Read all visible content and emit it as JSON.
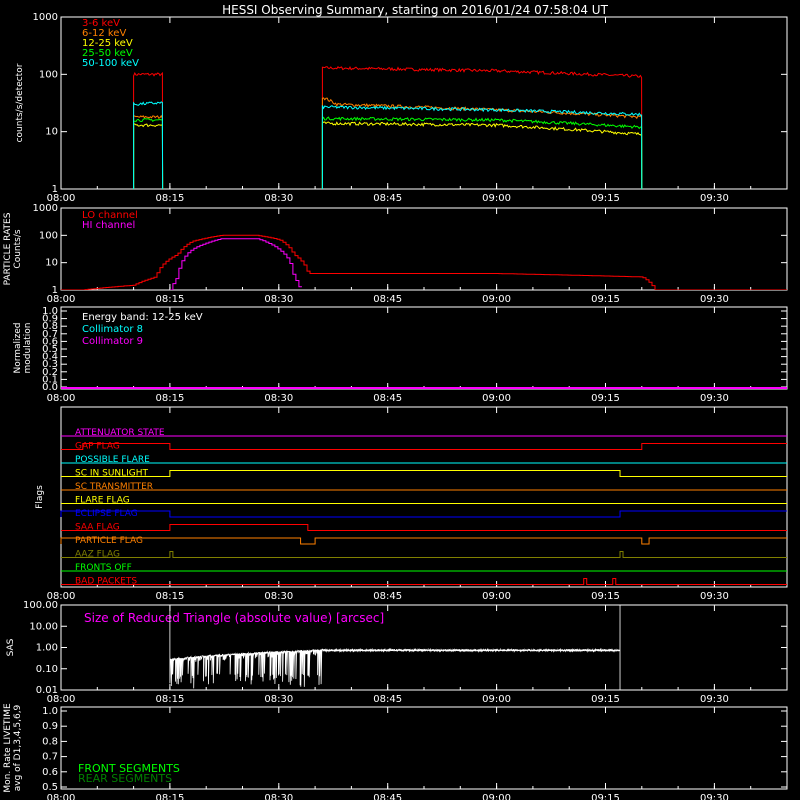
{
  "title": "HESSI Observing Summary, starting on 2016/01/24 07:58:04 UT",
  "time_axis": {
    "start": "08:00",
    "end": "09:40",
    "ticks": [
      "08:00",
      "08:15",
      "08:30",
      "08:45",
      "09:00",
      "09:15",
      "09:30"
    ]
  },
  "colors": {
    "background": "#000000",
    "axes": "#ffffff",
    "band_3_6": "#ff0000",
    "band_6_12": "#ff8000",
    "band_12_25": "#ffff00",
    "band_25_50": "#00ff00",
    "band_50_100": "#00ffff",
    "lo_channel": "#ff0000",
    "hi_channel": "#ff00ff",
    "collimator_8": "#00ffff",
    "collimator_9": "#ff00ff",
    "sas_trace": "#ffffff",
    "front_segments": "#00ff00",
    "rear_segments": "#008000"
  },
  "chart_data": [
    {
      "id": "count-rates",
      "type": "line",
      "ylabel": "counts/s/detector",
      "yscale": "log",
      "ylim": [
        1,
        1000
      ],
      "yticks": [
        "1",
        "10",
        "100",
        "1000"
      ],
      "legend": [
        "3-6 keV",
        "6-12 keV",
        "12-25 keV",
        "25-50 keV",
        "50-100 keV"
      ],
      "legend_placement": "top-left",
      "series": [
        {
          "name": "3-6 keV",
          "color": "#ff0000",
          "segments": [
            [
              [
                "08:10",
                "100"
              ],
              [
                "08:14",
                "100"
              ]
            ],
            [
              [
                "08:36",
                "130"
              ],
              [
                "09:00",
                "115"
              ],
              [
                "09:20",
                "92"
              ]
            ]
          ]
        },
        {
          "name": "6-12 keV",
          "color": "#ff8000",
          "segments": [
            [
              [
                "08:10",
                "18"
              ],
              [
                "08:14",
                "18"
              ]
            ],
            [
              [
                "08:36",
                "40"
              ],
              [
                "08:38",
                "30"
              ],
              [
                "08:45",
                "28"
              ],
              [
                "09:00",
                "24"
              ],
              [
                "09:20",
                "18"
              ]
            ]
          ]
        },
        {
          "name": "12-25 keV",
          "color": "#ffff00",
          "segments": [
            [
              [
                "08:10",
                "13"
              ],
              [
                "08:14",
                "13"
              ]
            ],
            [
              [
                "08:36",
                "14"
              ],
              [
                "09:00",
                "13"
              ],
              [
                "09:20",
                "9"
              ]
            ]
          ]
        },
        {
          "name": "25-50 keV",
          "color": "#00ff00",
          "segments": [
            [
              [
                "08:10",
                "16"
              ],
              [
                "08:14",
                "16"
              ]
            ],
            [
              [
                "08:36",
                "17"
              ],
              [
                "09:00",
                "16"
              ],
              [
                "09:20",
                "12"
              ]
            ]
          ]
        },
        {
          "name": "50-100 keV",
          "color": "#00ffff",
          "segments": [
            [
              [
                "08:10",
                "30"
              ],
              [
                "08:14",
                "32"
              ]
            ],
            [
              [
                "08:36",
                "27"
              ],
              [
                "09:00",
                "24"
              ],
              [
                "09:20",
                "20"
              ]
            ]
          ]
        }
      ]
    },
    {
      "id": "particle-rates",
      "type": "line",
      "ylabel": "PARTICLE RATES Counts/s",
      "yscale": "log",
      "ylim": [
        1,
        1000
      ],
      "yticks": [
        "1",
        "10",
        "100",
        "1000"
      ],
      "legend": [
        "LO channel",
        "HI channel"
      ],
      "legend_placement": "top-left",
      "series": [
        {
          "name": "LO channel",
          "color": "#ff0000",
          "points": [
            [
              "08:00",
              "0.8"
            ],
            [
              "08:10",
              "1.5"
            ],
            [
              "08:13",
              "3"
            ],
            [
              "08:16",
              "20"
            ],
            [
              "08:18",
              "60"
            ],
            [
              "08:22",
              "100"
            ],
            [
              "08:27",
              "100"
            ],
            [
              "08:30",
              "70"
            ],
            [
              "08:32",
              "20"
            ],
            [
              "08:34",
              "4"
            ],
            [
              "09:00",
              "4"
            ],
            [
              "09:20",
              "3"
            ],
            [
              "09:22",
              "0.8"
            ],
            [
              "09:40",
              "0.8"
            ]
          ]
        },
        {
          "name": "HI channel",
          "color": "#ff00ff",
          "points": [
            [
              "08:15",
              "0.8"
            ],
            [
              "08:16",
              "3"
            ],
            [
              "08:18",
              "30"
            ],
            [
              "08:22",
              "75"
            ],
            [
              "08:27",
              "75"
            ],
            [
              "08:30",
              "30"
            ],
            [
              "08:32",
              "3"
            ],
            [
              "08:33",
              "0.8"
            ]
          ]
        }
      ]
    },
    {
      "id": "modulation",
      "type": "line",
      "ylabel": "Normalized modulation",
      "ylim": [
        0.0,
        1.0
      ],
      "yticks": [
        "0.0",
        "0.1",
        "0.2",
        "0.3",
        "0.4",
        "0.5",
        "0.6",
        "0.7",
        "0.8",
        "0.9",
        "1.0"
      ],
      "legend": [
        "Energy band: 12-25 keV",
        "Collimator 8",
        "Collimator 9"
      ],
      "legend_placement": "top-left",
      "series": [
        {
          "name": "Collimator 8",
          "color": "#00ffff",
          "points": [
            [
              "08:00",
              "0.0"
            ],
            [
              "09:40",
              "0.0"
            ]
          ]
        },
        {
          "name": "Collimator 9",
          "color": "#ff00ff",
          "points": [
            [
              "08:00",
              "0.0"
            ],
            [
              "09:40",
              "0.0"
            ]
          ]
        }
      ]
    },
    {
      "id": "flags",
      "type": "line",
      "ylabel": "Flags",
      "series": [
        {
          "name": "ATTENUATOR STATE",
          "color": "#ff00ff",
          "steps": []
        },
        {
          "name": "GAP FLAG",
          "color": "#ff0000",
          "steps": [
            [
              "08:00",
              "08:03",
              "off"
            ],
            [
              "08:03",
              "08:15",
              "on"
            ],
            [
              "08:15",
              "09:20",
              "off"
            ],
            [
              "09:20",
              "09:40",
              "on"
            ]
          ]
        },
        {
          "name": "POSSIBLE FLARE",
          "color": "#00ffff",
          "steps": []
        },
        {
          "name": "SC IN SUNLIGHT",
          "color": "#ffff00",
          "steps": [
            [
              "08:00",
              "08:15",
              "off"
            ],
            [
              "08:15",
              "09:17",
              "on"
            ],
            [
              "09:17",
              "09:40",
              "off"
            ]
          ]
        },
        {
          "name": "SC TRANSMITTER",
          "color": "#ff8000",
          "steps": []
        },
        {
          "name": "FLARE FLAG",
          "color": "#ffff00",
          "steps": []
        },
        {
          "name": "ECLIPSE FLAG",
          "color": "#0000ff",
          "steps": [
            [
              "08:00",
              "08:15",
              "on"
            ],
            [
              "08:15",
              "09:17",
              "off"
            ],
            [
              "09:17",
              "09:40",
              "on"
            ]
          ]
        },
        {
          "name": "SAA FLAG",
          "color": "#ff0000",
          "steps": [
            [
              "08:00",
              "08:15",
              "off"
            ],
            [
              "08:15",
              "08:34",
              "on"
            ],
            [
              "08:34",
              "09:40",
              "off"
            ]
          ]
        },
        {
          "name": "PARTICLE FLAG",
          "color": "#ff8000",
          "steps": [
            [
              "08:00",
              "08:33",
              "on"
            ],
            [
              "08:33",
              "08:35",
              "off"
            ],
            [
              "08:35",
              "09:20",
              "on"
            ],
            [
              "09:20",
              "09:21",
              "off"
            ],
            [
              "09:21",
              "09:40",
              "on"
            ]
          ]
        },
        {
          "name": "AAZ FLAG",
          "color": "#808000",
          "steps": [
            [
              "08:15",
              "08:15",
              "spike"
            ],
            [
              "09:17",
              "09:17",
              "spike"
            ]
          ]
        },
        {
          "name": "FRONTS OFF",
          "color": "#00ff00",
          "steps": []
        },
        {
          "name": "BAD PACKETS",
          "color": "#ff0000",
          "steps": [
            [
              "09:12",
              "09:12",
              "spike"
            ],
            [
              "09:16",
              "09:16",
              "spike"
            ]
          ]
        }
      ]
    },
    {
      "id": "sas",
      "type": "line",
      "title": "Size of Reduced Triangle (absolute value) [arcsec]",
      "ylabel": "SAS",
      "yscale": "log",
      "ylim": [
        0.01,
        100
      ],
      "yticks": [
        "0.01",
        "0.10",
        "1.00",
        "10.00",
        "100.00"
      ],
      "series": [
        {
          "name": "SAS",
          "color": "#ffffff",
          "points": [
            [
              "08:15",
              "100"
            ],
            [
              "08:16",
              "0.3"
            ],
            [
              "08:30",
              "0.6"
            ],
            [
              "08:36",
              "0.7"
            ],
            [
              "09:00",
              "0.75"
            ],
            [
              "09:17",
              "0.7"
            ],
            [
              "09:17",
              "100"
            ]
          ]
        }
      ]
    },
    {
      "id": "livetime",
      "type": "line",
      "ylabel": "Mon. Rate LIVETIME avg of D1,3,4,5,6,9",
      "ylim": [
        0.5,
        1.0
      ],
      "yticks": [
        "0.5",
        "0.6",
        "0.7",
        "0.8",
        "0.9",
        "1.0"
      ],
      "legend": [
        "FRONT SEGMENTS",
        "REAR SEGMENTS"
      ],
      "legend_placement": "bottom-left",
      "series": []
    }
  ]
}
